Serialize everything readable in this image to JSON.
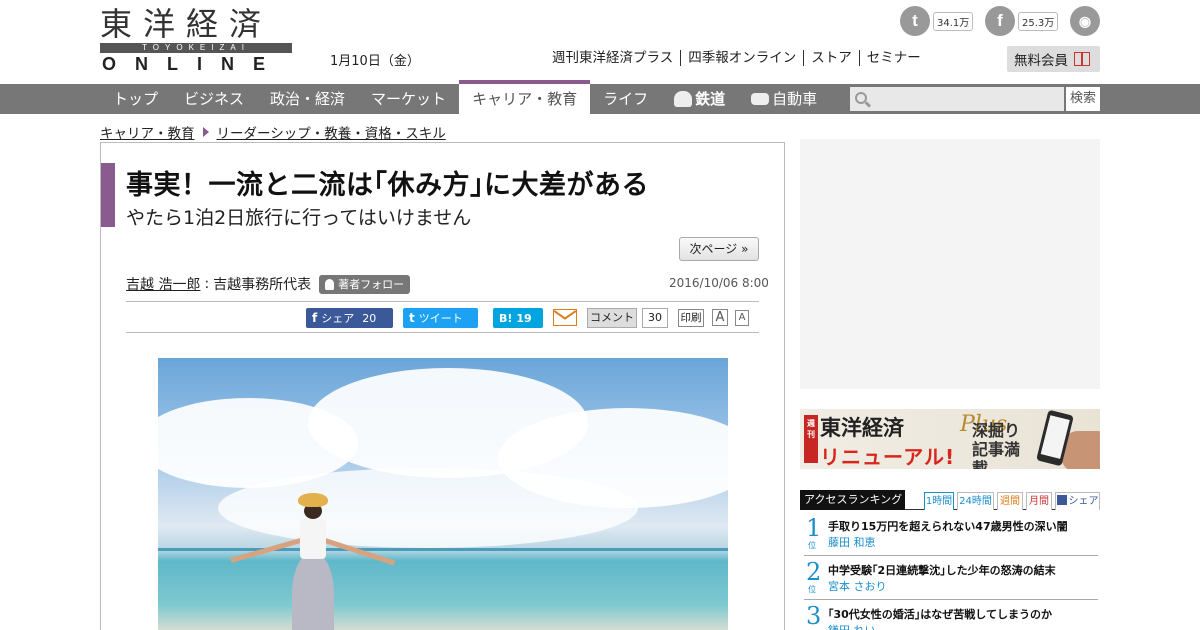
{
  "site": {
    "logo_kanji": "東洋経済",
    "logo_roman": "TOYOKEIZAI",
    "logo_online": "ONLINE",
    "date": "1月10日（金）"
  },
  "social": {
    "twitter_count": "34.1万",
    "facebook_count": "25.3万"
  },
  "top_links": [
    "週刊東洋経済プラス",
    "四季報オンライン",
    "ストア",
    "セミナー"
  ],
  "member_button": "無料会員",
  "nav": {
    "items": [
      "トップ",
      "ビジネス",
      "政治・経済",
      "マーケット",
      "キャリア・教育",
      "ライフ",
      "鉄道",
      "自動車"
    ],
    "active_index": 4,
    "search_button": "検索"
  },
  "breadcrumb": [
    "キャリア・教育",
    "リーダーシップ・教養・資格・スキル"
  ],
  "article": {
    "title": "事実！一流と二流は｢休み方｣に大差がある",
    "subtitle": "やたら1泊2日旅行に行ってはいけません",
    "next_page": "次ページ »",
    "author_name": "吉越 浩一郎",
    "author_separator": " : ",
    "author_role": "吉越事務所代表",
    "follow_label": "著者フォロー",
    "published": "2016/10/06 8:00",
    "accent_color": "#8a5b8e"
  },
  "share": {
    "fb_label": "シェア",
    "fb_count": "20",
    "tw_label": "ツイート",
    "hb_label": "B!",
    "hb_count": "19",
    "comment_label": "コメント",
    "comment_count": "30",
    "print_label": "印刷",
    "font_big": "A",
    "font_small": "A"
  },
  "plus_banner": {
    "badge": "週刊",
    "brand": "東洋経済",
    "plus": "Plus",
    "renewal": "リニューアル!",
    "feature": "深掘り記事満載"
  },
  "ranking": {
    "title": "アクセスランキング",
    "tabs": [
      "1時間",
      "24時間",
      "週間",
      "月間",
      "シェア"
    ],
    "rank_suffix": "位",
    "items": [
      {
        "rank": "1",
        "title": "手取り15万円を超えられない47歳男性の深い闇",
        "author": "藤田 和恵"
      },
      {
        "rank": "2",
        "title": "中学受験｢2日連続撃沈｣した少年の怒涛の結末",
        "author": "宮本 さおり"
      },
      {
        "rank": "3",
        "title": "｢30代女性の婚活｣はなぜ苦戦してしまうのか",
        "author": "鎌田 れい"
      }
    ]
  }
}
